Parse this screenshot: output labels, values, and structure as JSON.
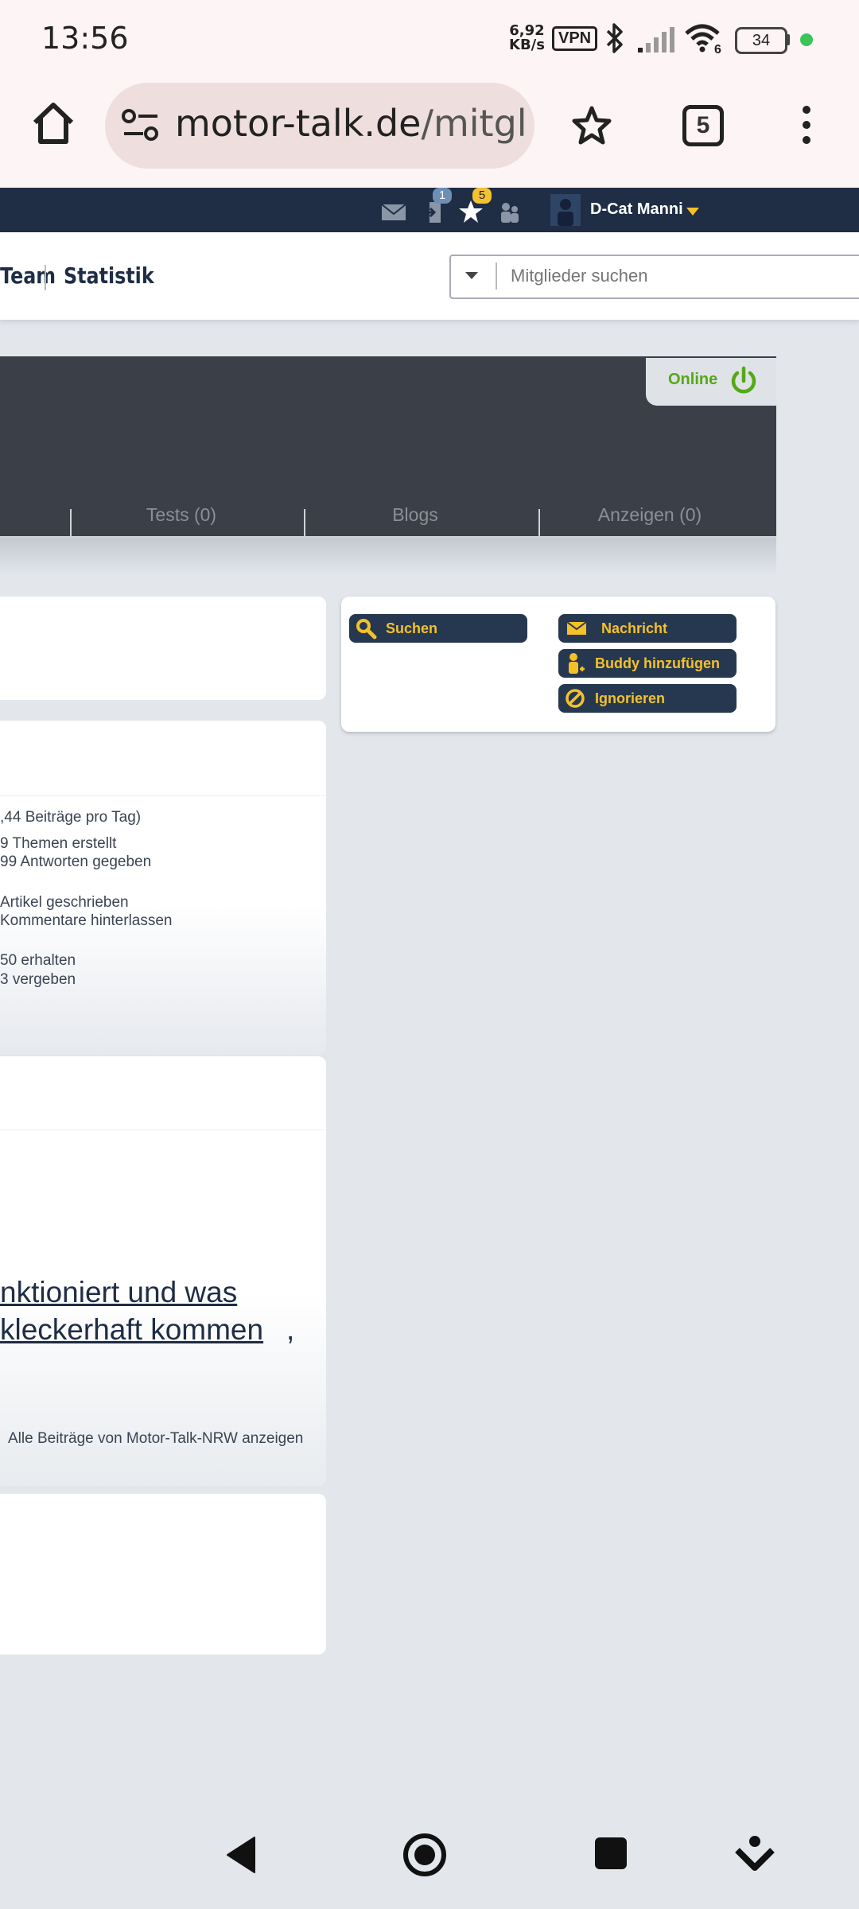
{
  "status_bar": {
    "time": "13:56",
    "net_speed_value": "6,92",
    "net_speed_unit": "KB/s",
    "vpn": "VPN",
    "battery": "34",
    "wifi_badge": "6"
  },
  "browser": {
    "url_host": "motor-talk.de",
    "url_path": "/mitglied",
    "tabs_count": "5"
  },
  "topbar": {
    "notification_count_1": "1",
    "notification_count_5": "5",
    "username": "D-Cat Manni"
  },
  "nav": {
    "team": "Team",
    "statistik": "Statistik",
    "search_placeholder": "Mitglieder suchen"
  },
  "profile": {
    "online_label": "Online",
    "tabs": [
      "Tests (0)",
      "Blogs",
      "Anzeigen (0)"
    ]
  },
  "actions": {
    "suchen": "Suchen",
    "nachricht": "Nachricht",
    "buddy": "Buddy hinzufügen",
    "ignorieren": "Ignorieren"
  },
  "stats": {
    "line1": ",44 Beiträge pro Tag)",
    "line2": "9 Themen erstellt",
    "line3": "99 Antworten gegeben",
    "line4": "Artikel geschrieben",
    "line5": "Kommentare hinterlassen",
    "line6": "50 erhalten",
    "line7": "3 vergeben"
  },
  "post": {
    "title_line1": "nktioniert und was",
    "title_line2": "kleckerhaft kommen",
    "title_comma": ",",
    "all_posts_link": "Alle Beiträge von Motor-Talk-NRW anzeigen"
  },
  "colors": {
    "topbar": "#1f2d45",
    "header": "#3a3f48",
    "button": "#26384f",
    "button_text": "#f4c12a",
    "online_green": "#55a818"
  }
}
